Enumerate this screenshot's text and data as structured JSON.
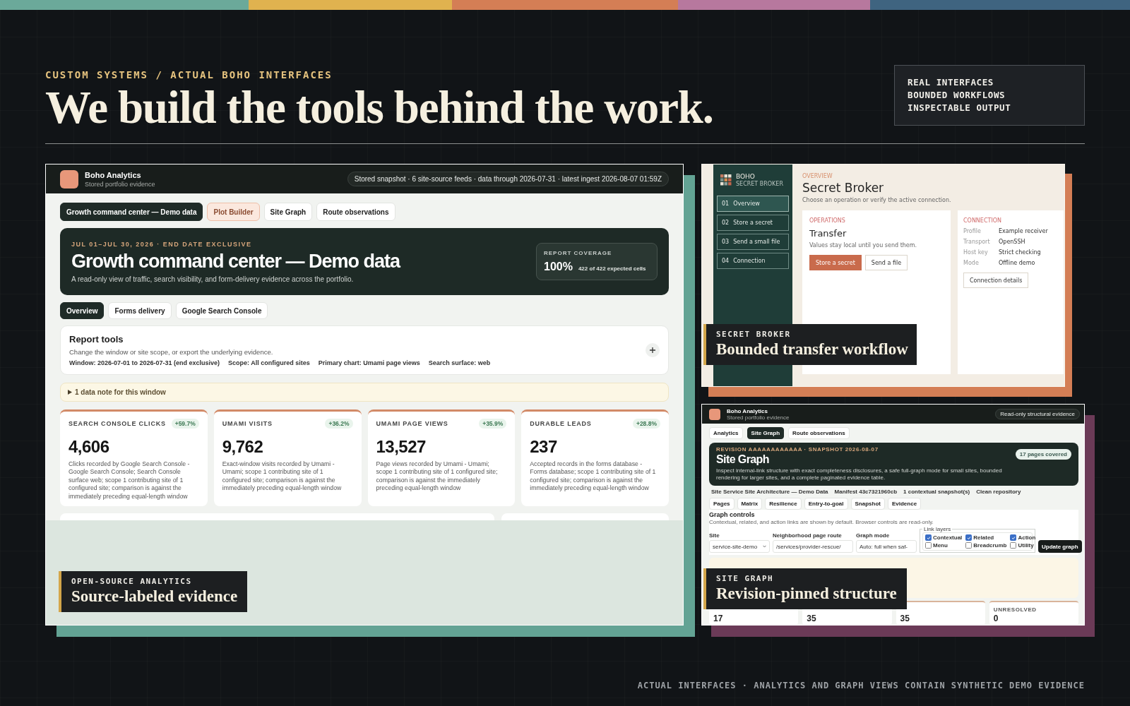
{
  "header": {
    "eyebrow": "CUSTOM SYSTEMS / ACTUAL BOHO INTERFACES",
    "headline": "We build the tools behind the work.",
    "highlights": [
      "REAL INTERFACES",
      "BOUNDED WORKFLOWS",
      "INSPECTABLE OUTPUT"
    ]
  },
  "analytics": {
    "app": {
      "name": "Boho Analytics",
      "subtitle": "Stored portfolio evidence",
      "status": "Stored snapshot · 6 site-source feeds · data through 2026-07-31 · latest ingest 2026-08-07 01:59Z"
    },
    "tabs": [
      {
        "label": "Growth command center — Demo data",
        "selected": true,
        "kind": "page"
      },
      {
        "label": "Plot Builder",
        "selected": false,
        "kind": "tool"
      },
      {
        "label": "Site Graph",
        "selected": false,
        "kind": "page"
      },
      {
        "label": "Route observations",
        "selected": false,
        "kind": "page"
      }
    ],
    "hero": {
      "eyebrow": "JUL 01–JUL 30, 2026 · END DATE EXCLUSIVE",
      "title": "Growth command center — Demo data",
      "description": "A read-only view of traffic, search visibility, and form-delivery evidence across the portfolio.",
      "coverage": {
        "label": "REPORT COVERAGE",
        "value": "100%",
        "detail": "422 of 422 expected cells"
      }
    },
    "subtabs": [
      {
        "label": "Overview",
        "selected": true
      },
      {
        "label": "Forms delivery",
        "selected": false
      },
      {
        "label": "Google Search Console",
        "selected": false
      }
    ],
    "report_tools": {
      "title": "Report tools",
      "description": "Change the window or site scope, or export the underlying evidence.",
      "facts": [
        "Window: 2026-07-01 to 2026-07-31 (end exclusive)",
        "Scope: All configured sites",
        "Primary chart: Umami page views",
        "Search surface: web"
      ]
    },
    "data_note": {
      "text": "1 data note for this window",
      "expanded": false
    },
    "metrics": [
      {
        "label": "SEARCH CONSOLE CLICKS",
        "change": "+59.7%",
        "value": "4,606",
        "description": "Clicks recorded by Google Search Console - Google Search Console; Search Console surface web; scope 1 contributing site of 1 configured site; comparison is against the immediately preceding equal-length window"
      },
      {
        "label": "UMAMI VISITS",
        "change": "+36.2%",
        "value": "9,762",
        "description": "Exact-window visits recorded by Umami - Umami; scope 1 contributing site of 1 configured site; comparison is against the immediately preceding equal-length window"
      },
      {
        "label": "UMAMI PAGE VIEWS",
        "change": "+35.9%",
        "value": "13,527",
        "description": "Page views recorded by Umami - Umami; scope 1 contributing site of 1 configured site; comparison is against the immediately preceding equal-length window"
      },
      {
        "label": "DURABLE LEADS",
        "change": "+28.8%",
        "value": "237",
        "description": "Accepted records in the forms database - Forms database; scope 1 contributing site of 1 configured site; comparison is against the immediately preceding equal-length window"
      }
    ],
    "caption": {
      "eyebrow": "OPEN-SOURCE ANALYTICS",
      "title": "Source-labeled evidence"
    }
  },
  "secret_broker": {
    "brand": {
      "name": "BOHO",
      "subtitle": "SECRET BROKER"
    },
    "nav": [
      {
        "number": "01",
        "label": "Overview",
        "selected": true
      },
      {
        "number": "02",
        "label": "Store a secret",
        "selected": false
      },
      {
        "number": "03",
        "label": "Send a small file",
        "selected": false
      },
      {
        "number": "04",
        "label": "Connection",
        "selected": false
      }
    ],
    "eyebrow": "OVERVIEW",
    "title": "Secret Broker",
    "description": "Choose an operation or verify the active connection.",
    "operations": {
      "eyebrow": "OPERATIONS",
      "title": "Transfer",
      "description": "Values stay local until you send them.",
      "buttons": [
        {
          "label": "Store a secret",
          "kind": "primary"
        },
        {
          "label": "Send a file",
          "kind": "secondary"
        }
      ]
    },
    "connection": {
      "eyebrow": "CONNECTION",
      "fields": [
        {
          "label": "Profile",
          "value": "Example receiver"
        },
        {
          "label": "Transport",
          "value": "OpenSSH"
        },
        {
          "label": "Host key",
          "value": "Strict checking"
        },
        {
          "label": "Mode",
          "value": "Offline demo"
        }
      ],
      "button": "Connection details"
    },
    "caption": {
      "eyebrow": "SECRET BROKER",
      "title": "Bounded transfer workflow"
    }
  },
  "site_graph": {
    "app": {
      "name": "Boho Analytics",
      "subtitle": "Stored portfolio evidence",
      "status": "Read-only structural evidence"
    },
    "tabs": [
      {
        "label": "Analytics",
        "selected": false
      },
      {
        "label": "Site Graph",
        "selected": true
      },
      {
        "label": "Route observations",
        "selected": false
      }
    ],
    "hero": {
      "eyebrow": "REVISION AAAAAAAAAAAA · SNAPSHOT 2026-08-07",
      "title": "Site Graph",
      "description": "Inspect internal-link structure with exact completeness disclosures, a safe full-graph mode for small sites, bounded rendering for larger sites, and a complete paginated evidence table.",
      "badge": "17 pages covered"
    },
    "meta": [
      "Site Service Site Architecture — Demo Data",
      "Manifest 43c7321960cb",
      "1 contextual snapshot(s)",
      "Clean repository"
    ],
    "view_tabs": [
      {
        "label": "Pages",
        "selected": false
      },
      {
        "label": "Matrix",
        "selected": false
      },
      {
        "label": "Resilience",
        "selected": false
      },
      {
        "label": "Entry-to-goal",
        "selected": false
      },
      {
        "label": "Snapshot",
        "selected": false
      },
      {
        "label": "Evidence",
        "selected": false
      }
    ],
    "controls": {
      "title": "Graph controls",
      "description": "Contextual, related, and action links are shown by default. Browser controls are read-only.",
      "site": {
        "label": "Site",
        "value": "service-site-demo"
      },
      "route": {
        "label": "Neighborhood page route",
        "value": "/services/provider-rescue/"
      },
      "mode": {
        "label": "Graph mode",
        "value": "Auto: full when saf-"
      },
      "link_layers": {
        "legend": "Link layers",
        "options": [
          {
            "label": "Contextual",
            "checked": true
          },
          {
            "label": "Related",
            "checked": true
          },
          {
            "label": "Action",
            "checked": true
          },
          {
            "label": "Menu",
            "checked": false
          },
          {
            "label": "Breadcrumb",
            "checked": false
          },
          {
            "label": "Utility",
            "checked": false
          }
        ]
      },
      "update_button": "Update graph"
    },
    "stats": [
      {
        "value": "17"
      },
      {
        "value": "35"
      },
      {
        "value": "35"
      },
      {
        "label": "UNRESOLVED",
        "value": "0"
      }
    ],
    "caption": {
      "eyebrow": "SITE GRAPH",
      "title": "Revision-pinned structure"
    }
  },
  "footer": "ACTUAL INTERFACES · ANALYTICS AND GRAPH VIEWS CONTAIN SYNTHETIC DEMO EVIDENCE"
}
